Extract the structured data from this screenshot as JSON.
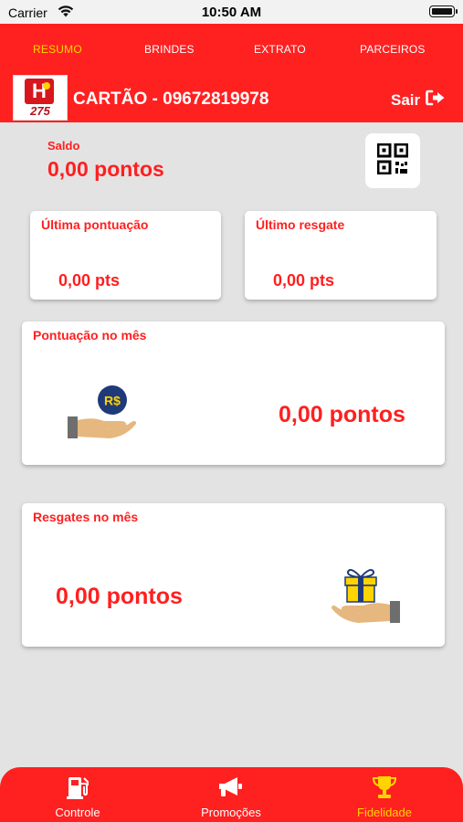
{
  "status_bar": {
    "carrier": "Carrier",
    "time": "10:50 AM"
  },
  "tabs": [
    {
      "label": "RESUMO",
      "active": true
    },
    {
      "label": "BRINDES",
      "active": false
    },
    {
      "label": "EXTRATO",
      "active": false
    },
    {
      "label": "PARCEIROS",
      "active": false
    }
  ],
  "header": {
    "logo_number": "275",
    "card_title": "CARTÃO - 09672819978",
    "logout_label": "Sair"
  },
  "balance": {
    "label": "Saldo",
    "value": "0,00 pontos"
  },
  "last_points": {
    "title": "Última pontuação",
    "value": "0,00 pts"
  },
  "last_redeem": {
    "title": "Último resgate",
    "value": "0,00 pts"
  },
  "month_points": {
    "title": "Pontuação no mês",
    "value": "0,00 pontos",
    "coin_label": "R$"
  },
  "month_redeems": {
    "title": "Resgates no mês",
    "value": "0,00 pontos"
  },
  "bottom_nav": [
    {
      "label": "Controle",
      "icon": "gas-pump-icon",
      "active": false
    },
    {
      "label": "Promoções",
      "icon": "megaphone-icon",
      "active": false
    },
    {
      "label": "Fidelidade",
      "icon": "trophy-icon",
      "active": true
    }
  ],
  "colors": {
    "primary": "#ff2020",
    "accent": "#ffd400",
    "background": "#e3e3e3"
  }
}
